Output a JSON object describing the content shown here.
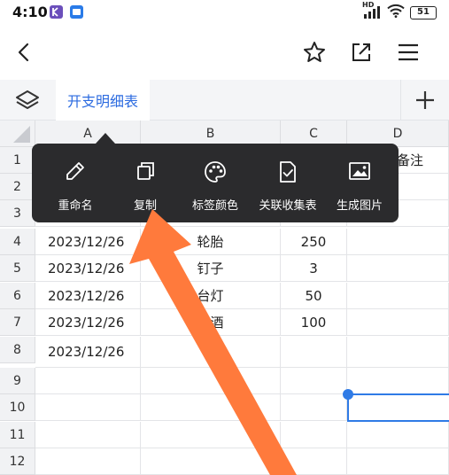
{
  "status_bar": {
    "time": "4:10",
    "signal_label": "HD",
    "battery": "51"
  },
  "toolbar": {
    "back_icon": "chevron-left-icon",
    "star_icon": "star-icon",
    "share_icon": "external-link-icon",
    "menu_icon": "hamburger-menu-icon"
  },
  "sheet_tabs": {
    "active_tab": "开支明细表",
    "add_icon": "plus-icon"
  },
  "grid": {
    "columns": [
      "A",
      "B",
      "C",
      "D"
    ],
    "rows": [
      "1",
      "2",
      "3",
      "4",
      "5",
      "6",
      "7",
      "8",
      "9",
      "10",
      "11",
      "12"
    ],
    "cells": {
      "D1": "备注",
      "A4": "2023/12/26",
      "B4": "轮胎",
      "C4": "250",
      "A5": "2023/12/26",
      "B5": "钉子",
      "C5": "3",
      "A6": "2023/12/26",
      "B6": "台灯",
      "C6": "50",
      "A7": "2023/12/26",
      "B7": "白酒",
      "C7": "100",
      "A8": "2023/12/26"
    }
  },
  "context_menu": {
    "items": [
      {
        "label": "重命名",
        "icon": "pencil-icon"
      },
      {
        "label": "复制",
        "icon": "copy-icon"
      },
      {
        "label": "标签颜色",
        "icon": "palette-icon"
      },
      {
        "label": "关联收集表",
        "icon": "form-check-icon"
      },
      {
        "label": "生成图片",
        "icon": "image-icon"
      }
    ]
  },
  "colors": {
    "accent": "#2c6be0",
    "menu_bg": "#2b2b2d",
    "arrow": "#ff7a3c"
  }
}
